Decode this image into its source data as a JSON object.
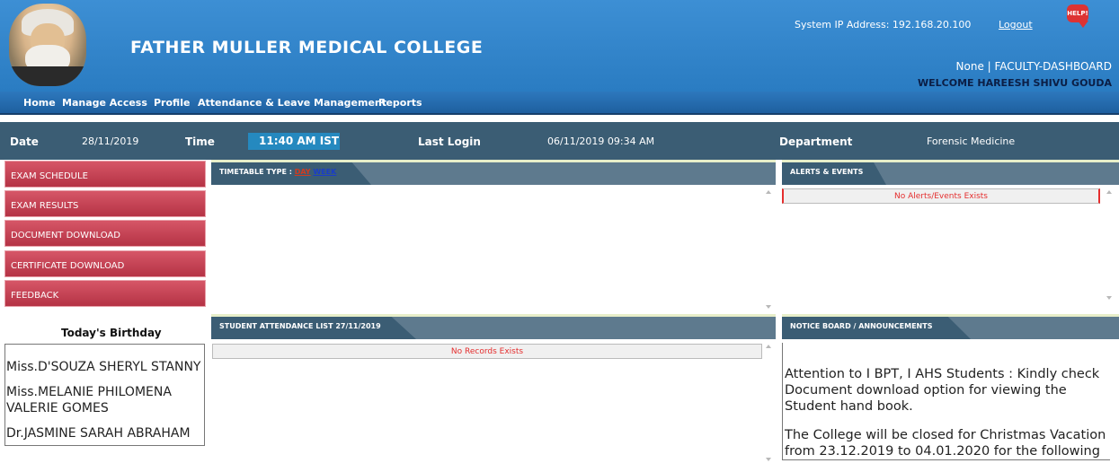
{
  "header": {
    "college_name": "FATHER MULLER MEDICAL COLLEGE",
    "system_ip": "System IP Address: 192.168.20.100",
    "logout_label": "Logout",
    "help_label": "HELP!",
    "role": "None | FACULTY-DASHBOARD",
    "welcome": "WELCOME HAREESH SHIVU GOUDA",
    "logo_icon": "college-founder-portrait"
  },
  "menu": {
    "items": [
      "Home",
      "Manage Access",
      "Profile",
      "Attendance & Leave Management",
      "Reports"
    ]
  },
  "info": {
    "date_label": "Date",
    "date_value": "28/11/2019",
    "time_label": "Time",
    "time_value": "11:40 AM IST",
    "last_login_label": "Last Login",
    "last_login_value": "06/11/2019 09:34 AM",
    "department_label": "Department",
    "department_value": "Forensic Medicine"
  },
  "sidebar": {
    "buttons": [
      "EXAM SCHEDULE",
      "EXAM RESULTS",
      "DOCUMENT DOWNLOAD",
      "CERTIFICATE DOWNLOAD",
      "FEEDBACK"
    ],
    "birthday_title": "Today's Birthday",
    "birthdays": [
      "Miss.D'SOUZA SHERYL STANNY",
      "Miss.MELANIE PHILOMENA VALERIE GOMES",
      "Dr.JASMINE SARAH ABRAHAM"
    ]
  },
  "timetable": {
    "type_label": "TIMETABLE TYPE : ",
    "day_label": "DAY",
    "week_label": "WEEK"
  },
  "alerts": {
    "title": "ALERTS & EVENTS",
    "empty_message": "No Alerts/Events Exists"
  },
  "attendance": {
    "title": "STUDENT ATTENDANCE LIST 27/11/2019",
    "empty_message": "No Records Exists"
  },
  "notice": {
    "title": "NOTICE BOARD / ANNOUNCEMENTS",
    "items": [
      "Attention to I BPT, I AHS Students : Kindly check Document download option for viewing the Student hand book.",
      "The College will be closed for Christmas Vacation from 23.12.2019 to 04.01.2020 for the following"
    ]
  },
  "colors": {
    "header_blue": "#2f83c9",
    "info_bar": "#3b5d74",
    "sidebar_red": "#c24255",
    "error_red": "#e52e2e"
  }
}
